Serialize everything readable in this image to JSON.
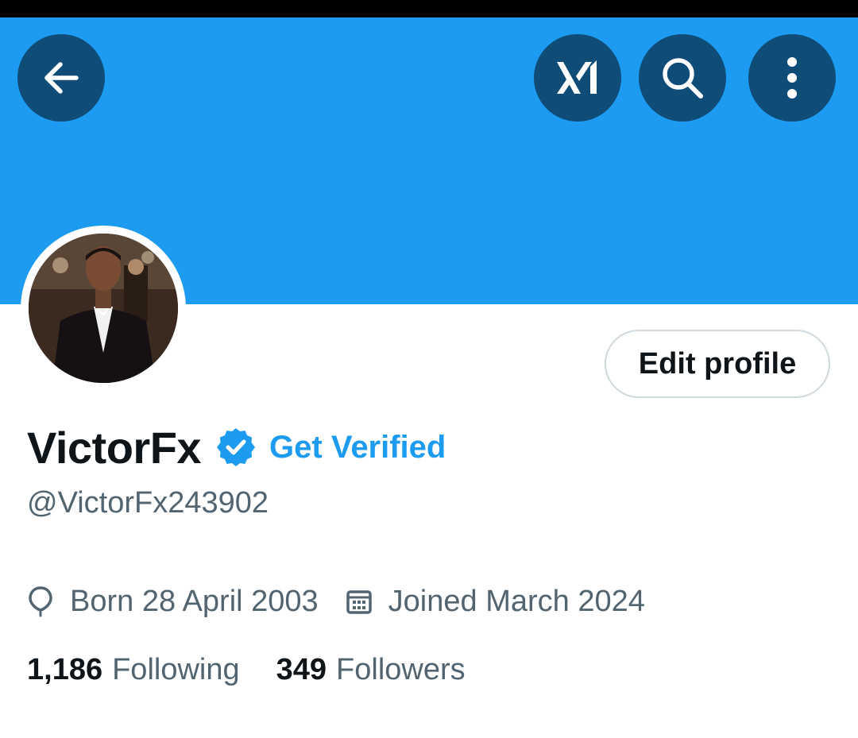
{
  "colors": {
    "banner": "#1d9bf0",
    "icon_button_bg": "#0f4c78",
    "accent": "#1d9bf0",
    "primary_text": "#0f1419",
    "secondary_text": "#536471"
  },
  "header": {
    "back_icon": "arrow-left-icon",
    "grok_icon": "grok-icon",
    "search_icon": "search-icon",
    "more_icon": "more-vertical-icon"
  },
  "profile": {
    "display_name": "VictorFx",
    "verified_icon": "verified-badge-icon",
    "get_verified_label": "Get Verified",
    "handle": "@VictorFx243902",
    "edit_profile_label": "Edit profile",
    "birth_icon": "balloon-icon",
    "birth_text": "Born 28 April 2003",
    "joined_icon": "calendar-icon",
    "joined_text": "Joined March 2024"
  },
  "stats": {
    "following_count": "1,186",
    "following_label": "Following",
    "followers_count": "349",
    "followers_label": "Followers"
  }
}
